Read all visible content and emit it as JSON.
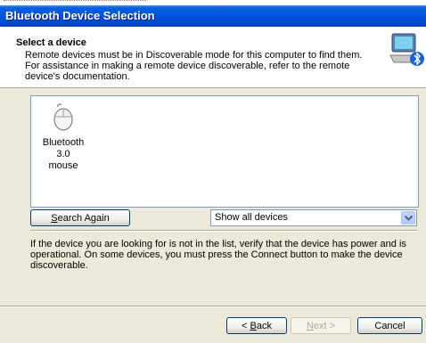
{
  "window": {
    "title": "Bluetooth Device Selection"
  },
  "header": {
    "title": "Select a device",
    "description_lines": [
      "Remote devices must be in Discoverable mode for this computer to find them.",
      "For assistance in making a remote device discoverable, refer to the remote",
      "device's documentation."
    ],
    "icon": "bluetooth-computer-icon"
  },
  "devices": [
    {
      "label_line1": "Bluetooth 3.0",
      "label_line2": "mouse",
      "icon": "mouse-icon"
    }
  ],
  "search_button": {
    "prefix": "",
    "mnemonic": "S",
    "rest": "earch Again"
  },
  "filter": {
    "selected": "Show all devices"
  },
  "info_lines": [
    "If the device you are looking for is not in the list, verify that the device has power and is",
    "operational. On some devices, you must press the Connect button to make the device",
    "discoverable."
  ],
  "footer": {
    "back": {
      "prefix": "< ",
      "mnemonic": "B",
      "rest": "ack"
    },
    "next": {
      "prefix": "",
      "mnemonic": "N",
      "rest": "ext >"
    },
    "cancel": "Cancel"
  },
  "colors": {
    "titlebar": "#0054e3",
    "dialog_bg": "#ece9d8",
    "border": "#7f9db9"
  }
}
